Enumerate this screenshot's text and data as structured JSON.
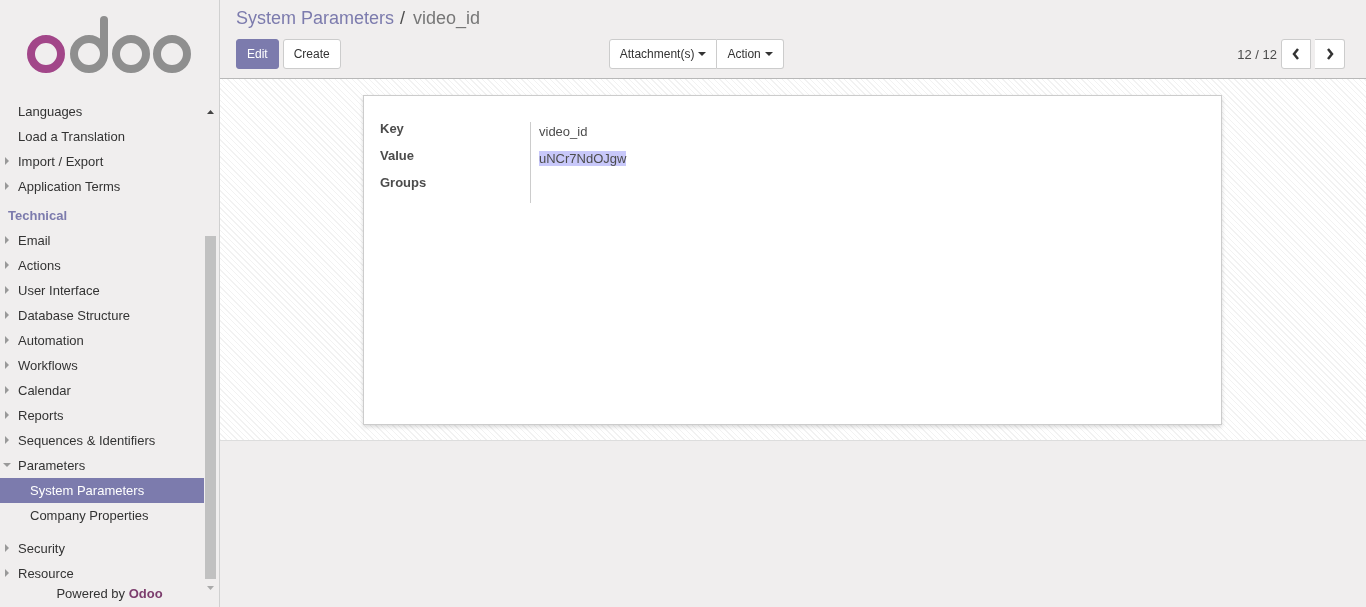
{
  "sidebar": {
    "items": [
      {
        "label": "Languages",
        "kind": "leaf",
        "selected": false
      },
      {
        "label": "Load a Translation",
        "kind": "leaf",
        "selected": false
      },
      {
        "label": "Import / Export",
        "kind": "folder",
        "expanded": false,
        "selected": false
      },
      {
        "label": "Application Terms",
        "kind": "folder",
        "expanded": false,
        "selected": false
      },
      {
        "label": "Technical",
        "kind": "section"
      },
      {
        "label": "Email",
        "kind": "folder",
        "expanded": false,
        "selected": false
      },
      {
        "label": "Actions",
        "kind": "folder",
        "expanded": false,
        "selected": false
      },
      {
        "label": "User Interface",
        "kind": "folder",
        "expanded": false,
        "selected": false
      },
      {
        "label": "Database Structure",
        "kind": "folder",
        "expanded": false,
        "selected": false
      },
      {
        "label": "Automation",
        "kind": "folder",
        "expanded": false,
        "selected": false
      },
      {
        "label": "Workflows",
        "kind": "folder",
        "expanded": false,
        "selected": false
      },
      {
        "label": "Calendar",
        "kind": "folder",
        "expanded": false,
        "selected": false
      },
      {
        "label": "Reports",
        "kind": "folder",
        "expanded": false,
        "selected": false
      },
      {
        "label": "Sequences & Identifiers",
        "kind": "folder",
        "expanded": false,
        "selected": false
      },
      {
        "label": "Parameters",
        "kind": "folder",
        "expanded": true,
        "selected": false,
        "children": [
          {
            "label": "System Parameters",
            "kind": "leaf",
            "selected": true
          },
          {
            "label": "Company Properties",
            "kind": "leaf",
            "selected": false
          }
        ]
      },
      {
        "label": "Security",
        "kind": "folder",
        "expanded": false,
        "selected": false
      },
      {
        "label": "Resource",
        "kind": "folder",
        "expanded": false,
        "selected": false
      }
    ],
    "footer": {
      "text": "Powered by",
      "link": "Odoo"
    }
  },
  "breadcrumb": {
    "parent": "System Parameters",
    "separator": "/",
    "current": "video_id"
  },
  "buttons": [
    {
      "label": "Edit",
      "primary": true
    },
    {
      "label": "Create",
      "primary": false
    }
  ],
  "dropdowns": [
    "Attachment(s)",
    "Action"
  ],
  "pager": {
    "text": "12 / 12"
  },
  "form": {
    "fields": [
      {
        "label": "Key",
        "value": "video_id",
        "highlighted": false
      },
      {
        "label": "Value",
        "value": "uNCr7NdOJgw",
        "highlighted": true
      },
      {
        "label": "Groups"
      }
    ]
  }
}
